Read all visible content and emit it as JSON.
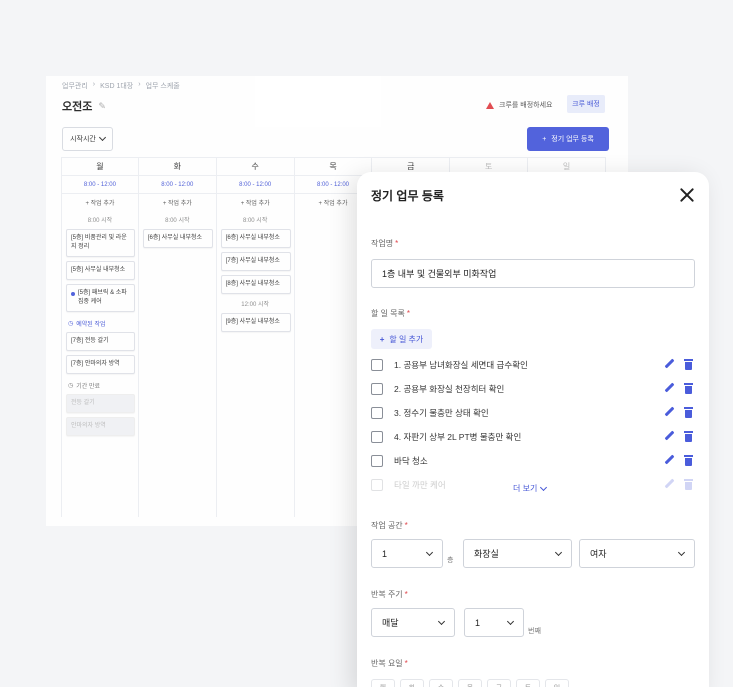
{
  "breadcrumb": [
    "업무관리",
    "KSD 1대장",
    "업무 스케줄"
  ],
  "page": {
    "title": "오전조"
  },
  "alert_text": "크루를 배정하세요",
  "assign_label": "크루 배정",
  "start_time_label": "시작시간",
  "register_label": "정기 업무 등록",
  "days": [
    "월",
    "화",
    "수",
    "목",
    "금",
    "토",
    "일"
  ],
  "time_range": "8:00 - 12:00",
  "add_task_label": "+ 작업 추가",
  "start_8": "8:00 시작",
  "start_12": "12:00 시작",
  "mon_cards": [
    "[5층] 비품관리 및 라운지 정리",
    "[5층] 사무실 내부청소",
    "[5층] 패브릭 & 소파 집중 케어"
  ],
  "mon_section_label": "예약된 작업",
  "mon_reserved": [
    "[7층] 전등 갈기",
    "[7층] 안마의자 방역"
  ],
  "mon_expired_label": "기간 만료",
  "mon_expired": [
    "전등 갈기",
    "안마의자 방역"
  ],
  "tue_cards": [
    "[6층] 사무실 내부청소"
  ],
  "wed_cards_8": [
    "[6층] 사무실 내부청소",
    "[7층] 사무실 내부청소",
    "[8층] 사무실 내부청소"
  ],
  "wed_cards_12": [
    "[9층] 사무실 내부청소"
  ],
  "modal": {
    "title": "정기 업무 등록",
    "work_name_label": "작업명",
    "work_name_value": "1층 내부 및 건물외부 미화작업",
    "todo_label": "할 일 목록",
    "todo_add_label": "할 일 추가",
    "todos": [
      "1. 공용부 남녀화장실 세면대 급수확인",
      "2. 공용부 화장실 천장히터 확인",
      "3. 정수기 물충만 상태 확인",
      "4. 자판기 상부 2L PT병 물충만 확인",
      "바닥 청소",
      "타일 까만 케어"
    ],
    "more_label": "더 보기",
    "space_label": "작업 공간",
    "floor_value": "1",
    "floor_unit": "층",
    "room_value": "화장실",
    "gender_value": "여자",
    "repeat_label": "반복 주기",
    "repeat_value": "매달",
    "repeat_n": "1",
    "repeat_unit": "번째",
    "repeat_day_label": "반복 요일",
    "repeat_days": [
      "월",
      "화",
      "수",
      "목",
      "금",
      "토",
      "일"
    ]
  },
  "colors": {
    "primary": "#4a5cdb",
    "required": "#e0454a"
  }
}
